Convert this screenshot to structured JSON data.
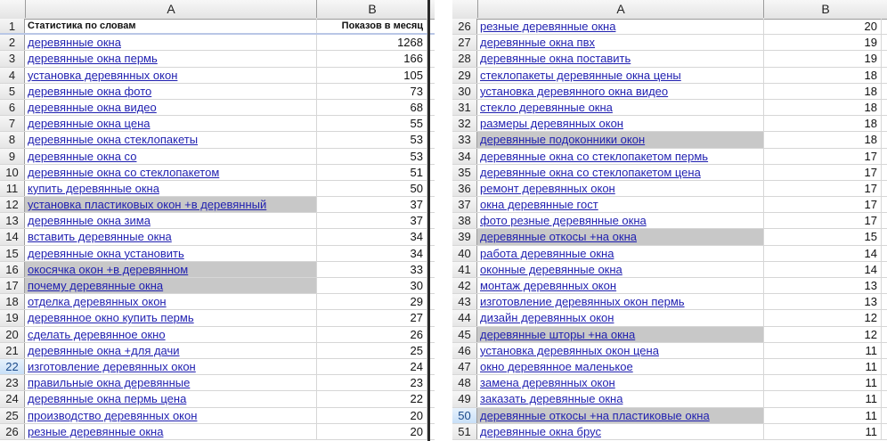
{
  "left": {
    "col_headers": [
      "A",
      "B"
    ],
    "header_row": {
      "num": "1",
      "a": "Статистика по словам",
      "b": "Показов в месяц"
    },
    "rows": [
      {
        "num": "2",
        "a": "деревянные окна",
        "b": "1268",
        "hl": false
      },
      {
        "num": "3",
        "a": "деревянные окна пермь",
        "b": "166",
        "hl": false
      },
      {
        "num": "4",
        "a": "установка деревянных окон",
        "b": "105",
        "hl": false
      },
      {
        "num": "5",
        "a": "деревянные окна фото",
        "b": "73",
        "hl": false
      },
      {
        "num": "6",
        "a": "деревянные окна видео",
        "b": "68",
        "hl": false
      },
      {
        "num": "7",
        "a": "деревянные окна цена",
        "b": "55",
        "hl": false
      },
      {
        "num": "8",
        "a": "деревянные окна стеклопакеты",
        "b": "53",
        "hl": false
      },
      {
        "num": "9",
        "a": "деревянные окна со",
        "b": "53",
        "hl": false
      },
      {
        "num": "10",
        "a": "деревянные окна со стеклопакетом",
        "b": "51",
        "hl": false
      },
      {
        "num": "11",
        "a": "купить деревянные окна",
        "b": "50",
        "hl": false
      },
      {
        "num": "12",
        "a": "установка пластиковых окон +в деревянный",
        "b": "37",
        "hl": true
      },
      {
        "num": "13",
        "a": "деревянные окна зима",
        "b": "37",
        "hl": false
      },
      {
        "num": "14",
        "a": "вставить деревянные окна",
        "b": "34",
        "hl": false
      },
      {
        "num": "15",
        "a": "деревянные окна установить",
        "b": "34",
        "hl": false
      },
      {
        "num": "16",
        "a": "окосячка окон +в деревянном",
        "b": "33",
        "hl": true
      },
      {
        "num": "17",
        "a": "почему деревянные окна",
        "b": "30",
        "hl": true
      },
      {
        "num": "18",
        "a": "отделка деревянных окон",
        "b": "29",
        "hl": false
      },
      {
        "num": "19",
        "a": "деревянное окно купить пермь",
        "b": "27",
        "hl": false
      },
      {
        "num": "20",
        "a": "сделать деревянное окно",
        "b": "26",
        "hl": false
      },
      {
        "num": "21",
        "a": "деревянные окна +для дачи",
        "b": "25",
        "hl": false
      },
      {
        "num": "22",
        "a": "изготовление деревянных окон",
        "b": "24",
        "hl": false,
        "sel": true
      },
      {
        "num": "23",
        "a": "правильные окна деревянные",
        "b": "23",
        "hl": false
      },
      {
        "num": "24",
        "a": "деревянные окна пермь цена",
        "b": "22",
        "hl": false
      },
      {
        "num": "25",
        "a": "производство деревянных окон",
        "b": "20",
        "hl": false
      },
      {
        "num": "26",
        "a": "резные деревянные окна",
        "b": "20",
        "hl": false
      }
    ]
  },
  "right": {
    "col_headers": [
      "A",
      "B"
    ],
    "rows": [
      {
        "num": "26",
        "a": "резные деревянные окна",
        "b": "20",
        "hl": false
      },
      {
        "num": "27",
        "a": "деревянные окна пвх",
        "b": "19",
        "hl": false
      },
      {
        "num": "28",
        "a": "деревянные окна поставить",
        "b": "19",
        "hl": false
      },
      {
        "num": "29",
        "a": "стеклопакеты деревянные окна цены",
        "b": "18",
        "hl": false
      },
      {
        "num": "30",
        "a": "установка деревянного окна видео",
        "b": "18",
        "hl": false
      },
      {
        "num": "31",
        "a": "стекло деревянные окна",
        "b": "18",
        "hl": false
      },
      {
        "num": "32",
        "a": "размеры деревянных окон",
        "b": "18",
        "hl": false
      },
      {
        "num": "33",
        "a": "деревянные подоконники окон",
        "b": "18",
        "hl": true
      },
      {
        "num": "34",
        "a": "деревянные окна со стеклопакетом пермь",
        "b": "17",
        "hl": false
      },
      {
        "num": "35",
        "a": "деревянные окна со стеклопакетом цена",
        "b": "17",
        "hl": false
      },
      {
        "num": "36",
        "a": "ремонт деревянных окон",
        "b": "17",
        "hl": false
      },
      {
        "num": "37",
        "a": "окна деревянные гост",
        "b": "17",
        "hl": false
      },
      {
        "num": "38",
        "a": "фото резные деревянные окна",
        "b": "17",
        "hl": false
      },
      {
        "num": "39",
        "a": "деревянные откосы +на окна",
        "b": "15",
        "hl": true
      },
      {
        "num": "40",
        "a": "работа деревянные окна",
        "b": "14",
        "hl": false
      },
      {
        "num": "41",
        "a": "оконные деревянные окна",
        "b": "14",
        "hl": false
      },
      {
        "num": "42",
        "a": "монтаж деревянных окон",
        "b": "13",
        "hl": false
      },
      {
        "num": "43",
        "a": "изготовление деревянных окон пермь",
        "b": "13",
        "hl": false
      },
      {
        "num": "44",
        "a": "дизайн деревянных окон",
        "b": "12",
        "hl": false
      },
      {
        "num": "45",
        "a": "деревянные шторы +на окна",
        "b": "12",
        "hl": true
      },
      {
        "num": "46",
        "a": "установка деревянных окон цена",
        "b": "11",
        "hl": false
      },
      {
        "num": "47",
        "a": "окно деревянное маленькое",
        "b": "11",
        "hl": false
      },
      {
        "num": "48",
        "a": "замена деревянных окон",
        "b": "11",
        "hl": false
      },
      {
        "num": "49",
        "a": "заказать деревянные окна",
        "b": "11",
        "hl": false
      },
      {
        "num": "50",
        "a": "деревянные откосы +на пластиковые окна",
        "b": "11",
        "hl": true,
        "sel": true
      },
      {
        "num": "51",
        "a": "деревянные окна брус",
        "b": "11",
        "hl": false
      }
    ]
  }
}
